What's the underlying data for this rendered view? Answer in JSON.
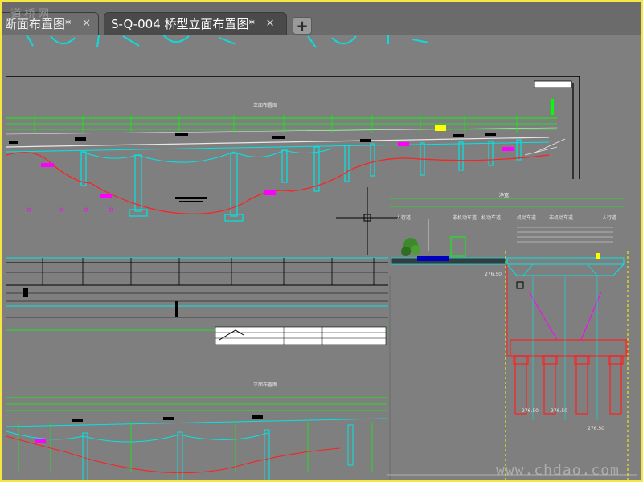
{
  "tabs": [
    {
      "label": "断面布置图*",
      "active": false
    },
    {
      "label": "S-Q-004 桥型立面布置图*",
      "active": true
    }
  ],
  "tab_close_glyph": "✕",
  "add_tab_glyph": "+",
  "watermark_top": "道桥网",
  "watermark_bottom": "www.chdao.com",
  "drawing": {
    "section_labels": [
      "人行道",
      "非机动车道",
      "机动车道",
      "机动车道",
      "非机动车道",
      "人行道"
    ],
    "elevations": [
      "276.50",
      "276.50",
      "276.50",
      "276.50"
    ],
    "colors": {
      "background": "#7f7f7f",
      "cyan": "#00e5e5",
      "green": "#00ff00",
      "red": "#ff2020",
      "magenta": "#ff00ff",
      "yellow": "#ffff00",
      "white": "#ffffff"
    }
  }
}
